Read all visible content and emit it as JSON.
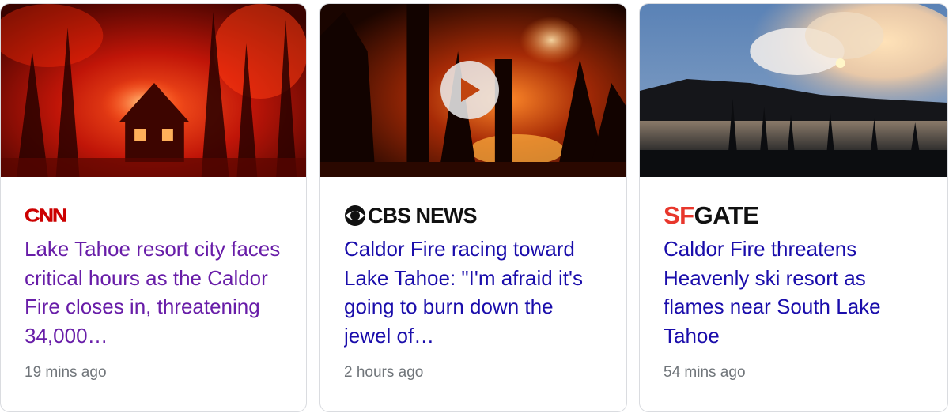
{
  "colors": {
    "link": "#1a0dab",
    "visited_link": "#681da8",
    "meta_text": "#70757a",
    "cnn_red": "#cc0000",
    "sfgate_red": "#e8372c",
    "border": "#dadce0"
  },
  "cards": [
    {
      "source_logo": "CNN",
      "headline": "Lake Tahoe resort city faces critical hours as the Caldor Fire closes in, threatening 34,000…",
      "time": "19 mins ago",
      "visited": true,
      "has_video": false,
      "image": "wildfire-burning-house"
    },
    {
      "source_logo": "CBS NEWS",
      "headline": "Caldor Fire racing toward Lake Tahoe: \"I'm afraid it's going to burn down the jewel of…",
      "time": "2 hours ago",
      "visited": false,
      "has_video": true,
      "play_icon": "play-icon",
      "image": "forest-fire-at-night"
    },
    {
      "source_logo_parts": [
        "SF",
        "GATE"
      ],
      "headline": "Caldor Fire threatens Heavenly ski resort as flames near South Lake Tahoe",
      "time": "54 mins ago",
      "visited": false,
      "has_video": false,
      "image": "smoke-over-lake"
    }
  ]
}
